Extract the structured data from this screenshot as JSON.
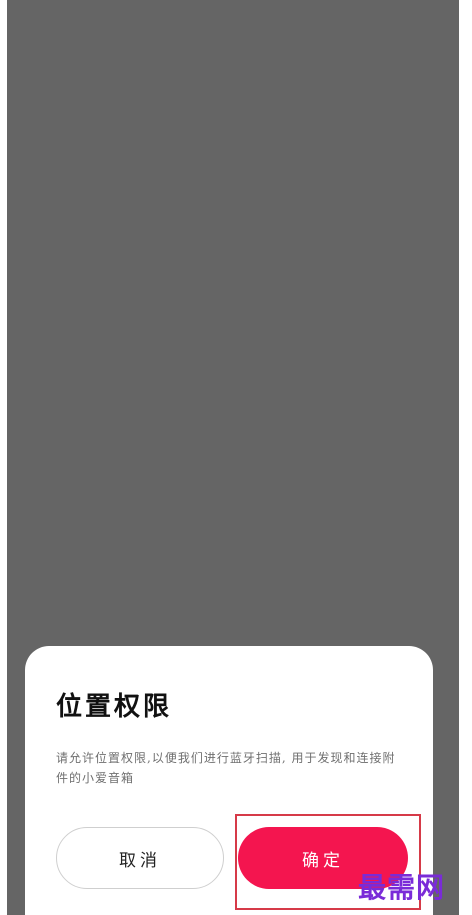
{
  "dialog": {
    "title": "位置权限",
    "message": "请允许位置权限,以便我们进行蓝牙扫描, 用于发现和连接附件的小爱音箱",
    "cancel_label": "取消",
    "confirm_label": "确定"
  },
  "watermark": {
    "text": "最需网"
  },
  "colors": {
    "overlay": "#656565",
    "confirm_button": "#f4154f",
    "highlight_box": "#d63a48",
    "watermark": "#7a2bd8"
  }
}
